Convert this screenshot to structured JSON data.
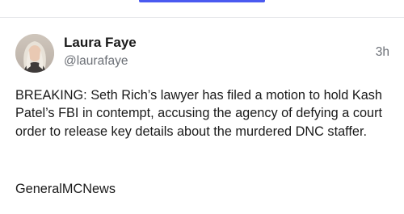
{
  "tabs": {
    "active_indicator_color": "#4a5af0"
  },
  "post": {
    "author": {
      "display_name": "Laura Faye",
      "handle": "@laurafaye",
      "avatar_icon": "profile-photo"
    },
    "timestamp": "3h",
    "body": "BREAKING: Seth Rich’s lawyer has filed a motion to hold Kash Patel’s FBI in contempt, accusing the agency of defying a court order to release key details about the murdered DNC staffer.",
    "source": "GeneralMCNews"
  }
}
